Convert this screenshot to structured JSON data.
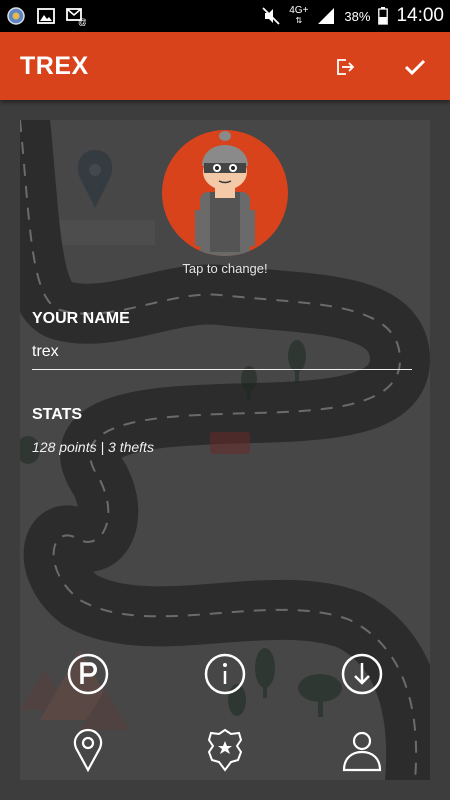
{
  "status_bar": {
    "network": "4G+",
    "battery": "38%",
    "time": "14:00",
    "icons": [
      "app-icon",
      "image-icon",
      "email-icon",
      "mute-icon",
      "signal-icon",
      "battery-icon"
    ]
  },
  "app_bar": {
    "title": "TREX",
    "icons": [
      "logout-icon",
      "checkmark-icon"
    ]
  },
  "profile": {
    "avatar_icon": "thief-avatar-icon",
    "tap_hint": "Tap to change!",
    "name_label": "YOUR NAME",
    "name_value": "trex",
    "stats_label": "STATS",
    "stats_value": "128 points | 3 thefts"
  },
  "bottom_nav": {
    "row1": [
      "parking-icon",
      "info-icon",
      "download-icon"
    ],
    "row2": [
      "location-pin-icon",
      "police-badge-icon",
      "person-icon"
    ]
  },
  "colors": {
    "accent": "#d9431b",
    "status_bar": "#000000",
    "background": "#3d3d3d",
    "card": "#474747"
  }
}
